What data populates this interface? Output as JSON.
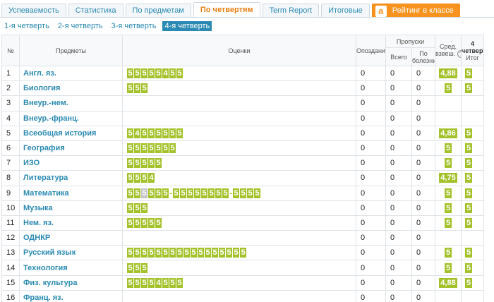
{
  "tabs": [
    {
      "label": "Успеваемость",
      "active": false
    },
    {
      "label": "Статистика",
      "active": false
    },
    {
      "label": "По предметам",
      "active": false
    },
    {
      "label": "По четвертям",
      "active": true
    },
    {
      "label": "Term Report",
      "active": false
    },
    {
      "label": "Итоговые",
      "active": false
    }
  ],
  "rating": {
    "icon": "a",
    "label": "Рейтинг в классе"
  },
  "quarters": [
    {
      "label": "1-я четверть",
      "active": false
    },
    {
      "label": "2-я четверть",
      "active": false
    },
    {
      "label": "3-я четверть",
      "active": false
    },
    {
      "label": "4-я четверть",
      "active": true
    }
  ],
  "headers": {
    "num": "№",
    "subjects": "Предметы",
    "marks": "Оценки",
    "late": "Опоздания",
    "absences": "Пропуски",
    "abs_total": "Всего",
    "abs_ill_1": "По",
    "abs_ill_2": "болезни",
    "avg_1": "Сред.",
    "avg_2": "взвеш.",
    "help_icon": "?",
    "final_1": "4",
    "final_2": "четверть",
    "final_3": "Итог"
  },
  "rows": [
    {
      "num": "1",
      "subject": "Англ. яз.",
      "marks": [
        "5",
        "5",
        "5",
        "5",
        "5",
        "4",
        "5",
        "5"
      ],
      "late": "0",
      "abs_total": "0",
      "abs_ill": "0",
      "avg": "4,88",
      "final": "5"
    },
    {
      "num": "2",
      "subject": "Биология",
      "marks": [
        "5",
        "5",
        "5"
      ],
      "late": "0",
      "abs_total": "0",
      "abs_ill": "0",
      "avg": "5",
      "final": "5"
    },
    {
      "num": "3",
      "subject": "Внеур.-нем.",
      "marks": [],
      "late": "0",
      "abs_total": "0",
      "abs_ill": "0",
      "avg": "",
      "final": ""
    },
    {
      "num": "4",
      "subject": "Внеур.-франц.",
      "marks": [],
      "late": "0",
      "abs_total": "0",
      "abs_ill": "0",
      "avg": "",
      "final": ""
    },
    {
      "num": "5",
      "subject": "Всеобщая история",
      "marks": [
        "5",
        "4",
        "5",
        "5",
        "5",
        "5",
        "5",
        "5"
      ],
      "late": "0",
      "abs_total": "0",
      "abs_ill": "0",
      "avg": "4,86",
      "final": "5"
    },
    {
      "num": "6",
      "subject": "География",
      "marks": [
        "5",
        "5",
        "5",
        "5",
        "5",
        "5",
        "5"
      ],
      "late": "0",
      "abs_total": "0",
      "abs_ill": "0",
      "avg": "5",
      "final": "5"
    },
    {
      "num": "7",
      "subject": "ИЗО",
      "marks": [
        "5",
        "5",
        "5",
        "5",
        "5"
      ],
      "late": "0",
      "abs_total": "0",
      "abs_ill": "0",
      "avg": "5",
      "final": "5"
    },
    {
      "num": "8",
      "subject": "Литература",
      "marks": [
        "5",
        "5",
        "5",
        "4"
      ],
      "late": "0",
      "abs_total": "0",
      "abs_ill": "0",
      "avg": "4,75",
      "final": "5"
    },
    {
      "num": "9",
      "subject": "Математика",
      "marks": [
        "5",
        "5",
        "5g",
        "5",
        "5",
        "5",
        "-",
        "5",
        "5",
        "5",
        "5",
        "5",
        "5",
        "5",
        "5",
        "-",
        "5",
        "5",
        "5",
        "5"
      ],
      "late": "0",
      "abs_total": "0",
      "abs_ill": "0",
      "avg": "5",
      "final": "5"
    },
    {
      "num": "10",
      "subject": "Музыка",
      "marks": [
        "5",
        "5",
        "5"
      ],
      "late": "0",
      "abs_total": "0",
      "abs_ill": "0",
      "avg": "5",
      "final": "5"
    },
    {
      "num": "11",
      "subject": "Нем. яз.",
      "marks": [
        "5",
        "5",
        "5",
        "5",
        "5"
      ],
      "late": "0",
      "abs_total": "0",
      "abs_ill": "0",
      "avg": "5",
      "final": "5"
    },
    {
      "num": "12",
      "subject": "ОДНКР",
      "marks": [],
      "late": "0",
      "abs_total": "0",
      "abs_ill": "0",
      "avg": "",
      "final": ""
    },
    {
      "num": "13",
      "subject": "Русский язык",
      "marks": [
        "5",
        "5",
        "5",
        "5",
        "5",
        "5",
        "5",
        "5",
        "5",
        "5",
        "5",
        "5",
        "5",
        "5",
        "5",
        "5",
        "5"
      ],
      "late": "0",
      "abs_total": "0",
      "abs_ill": "0",
      "avg": "5",
      "final": "5"
    },
    {
      "num": "14",
      "subject": "Технология",
      "marks": [
        "5",
        "5",
        "5"
      ],
      "late": "0",
      "abs_total": "0",
      "abs_ill": "0",
      "avg": "5",
      "final": "5"
    },
    {
      "num": "15",
      "subject": "Физ. культура",
      "marks": [
        "5",
        "5",
        "5",
        "5",
        "4",
        "5",
        "5",
        "5"
      ],
      "late": "0",
      "abs_total": "0",
      "abs_ill": "0",
      "avg": "4,88",
      "final": "5"
    },
    {
      "num": "16",
      "subject": "Франц. яз.",
      "marks": [],
      "late": "0",
      "abs_total": "0",
      "abs_ill": "0",
      "avg": "",
      "final": ""
    }
  ],
  "colors": {
    "mark": "#a4c22b",
    "mark_grey": "#c5c5c5",
    "link": "#2a8ab3",
    "active_tab": "#e77f12",
    "rating": "#f7931e"
  }
}
